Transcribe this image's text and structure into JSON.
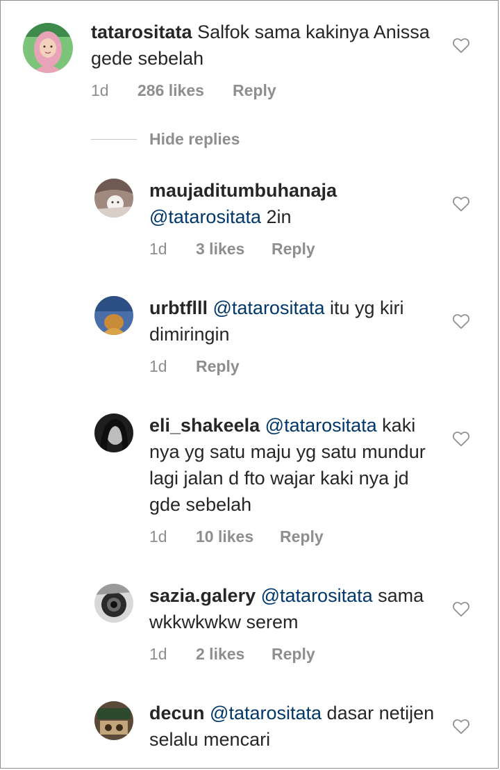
{
  "main_comment": {
    "username": "tatarositata",
    "text": "Salfok sama kakinya Anissa gede sebelah",
    "time": "1d",
    "likes": "286 likes",
    "reply": "Reply",
    "avatar_icon": "profile-photo-hijab-woman"
  },
  "hide_replies_label": "Hide replies",
  "replies": [
    {
      "username": "maujaditumbuhanaja",
      "mention": "@tatarositata",
      "text": "2in",
      "time": "1d",
      "likes": "3 likes",
      "reply": "Reply"
    },
    {
      "username": "urbtflll",
      "mention": "@tatarositata",
      "text": "itu yg kiri dimiringin",
      "time": "1d",
      "likes": "",
      "reply": "Reply"
    },
    {
      "username": "eli_shakeela",
      "mention": "@tatarositata",
      "text": "kaki nya yg satu maju yg satu mundur lagi jalan d fto wajar kaki nya jd gde sebelah",
      "time": "1d",
      "likes": "10 likes",
      "reply": "Reply"
    },
    {
      "username": "sazia.galery",
      "mention": "@tatarositata",
      "text": "sama wkkwkwkw serem",
      "time": "1d",
      "likes": "2 likes",
      "reply": "Reply"
    },
    {
      "username": "decun",
      "mention": "@tatarositata",
      "text": "dasar netijen selalu mencari",
      "time": "",
      "likes": "",
      "reply": ""
    }
  ],
  "colors": {
    "text": "#262626",
    "meta": "#8e8e8e",
    "mention": "#00376b",
    "divider": "#c7c7c7"
  }
}
